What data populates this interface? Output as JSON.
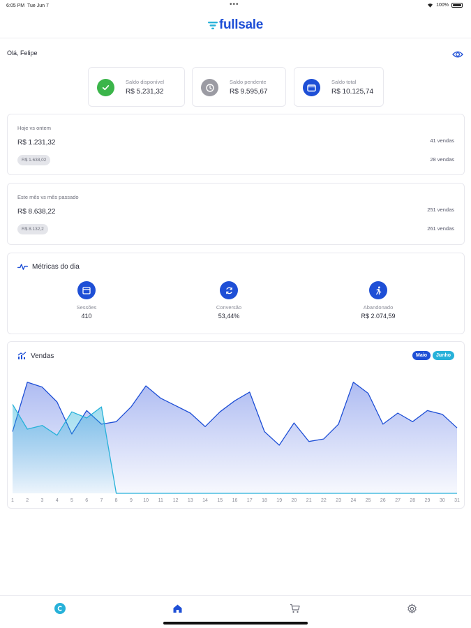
{
  "status_bar": {
    "time": "6:05 PM",
    "date": "Tue Jun 7",
    "battery": "100%"
  },
  "header": {
    "logo_text": "fullsale",
    "brand_color": "#1e4fd6",
    "accent_color": "#27b1d9"
  },
  "greeting": "Olá, Felipe",
  "balances": [
    {
      "label": "Saldo disponível",
      "value": "R$ 5.231,32",
      "icon": "check-icon",
      "color": "#3bb54a"
    },
    {
      "label": "Saldo pendente",
      "value": "R$ 9.595,67",
      "icon": "clock-icon",
      "color": "#9b9ba3"
    },
    {
      "label": "Saldo total",
      "value": "R$ 10.125,74",
      "icon": "wallet-icon",
      "color": "#1e4fd6"
    }
  ],
  "today_vs_yesterday": {
    "title": "Hoje vs ontem",
    "value": "R$ 1.231,32",
    "previous": "R$ 1.638,02",
    "sales_current": "41 vendas",
    "sales_previous": "28 vendas"
  },
  "month_vs_last": {
    "title": "Este mês vs mês passado",
    "value": "R$ 8.638,22",
    "previous": "R$ 8.132,2",
    "sales_current": "251 vendas",
    "sales_previous": "261 vendas"
  },
  "metrics": {
    "title": "Métricas do dia",
    "items": [
      {
        "label": "Sessões",
        "value": "410",
        "icon": "browser-icon"
      },
      {
        "label": "Conversão",
        "value": "53,44%",
        "icon": "refresh-icon"
      },
      {
        "label": "Abandonado",
        "value": "R$ 2.074,59",
        "icon": "running-icon"
      }
    ]
  },
  "sales_chart": {
    "title": "Vendas",
    "legend": [
      {
        "label": "Maio",
        "color": "#1e4fd6"
      },
      {
        "label": "Junho",
        "color": "#27b1d9"
      }
    ]
  },
  "chart_data": {
    "type": "area",
    "x": [
      1,
      2,
      3,
      4,
      5,
      6,
      7,
      8,
      9,
      10,
      11,
      12,
      13,
      14,
      15,
      16,
      17,
      18,
      19,
      20,
      21,
      22,
      23,
      24,
      25,
      26,
      27,
      28,
      29,
      30,
      31
    ],
    "tick_labels": [
      "1",
      "2",
      "3",
      "4",
      "5",
      "6",
      "7",
      "8",
      "9",
      "10",
      "11",
      "12",
      "13",
      "14",
      "15",
      "16",
      "17",
      "18",
      "19",
      "20",
      "21",
      "22",
      "23",
      "24",
      "25",
      "26",
      "27",
      "28",
      "29",
      "30",
      "31"
    ],
    "ylim": [
      0,
      100
    ],
    "grid": false,
    "legend_position": "top-right",
    "series": [
      {
        "name": "Maio",
        "color": "#1e4fd6",
        "values": [
          50,
          90,
          86,
          74,
          48,
          67,
          56,
          58,
          70,
          87,
          77,
          71,
          65,
          54,
          66,
          75,
          82,
          50,
          39,
          57,
          42,
          44,
          56,
          90,
          81,
          56,
          65,
          58,
          67,
          64,
          53
        ]
      },
      {
        "name": "Junho",
        "color": "#27b1d9",
        "values": [
          72,
          52,
          55,
          47,
          66,
          61,
          70,
          0,
          0,
          0,
          0,
          0,
          0,
          0,
          0,
          0,
          0,
          0,
          0,
          0,
          0,
          0,
          0,
          0,
          0,
          0,
          0,
          0,
          0,
          0,
          0
        ]
      }
    ]
  },
  "tabbar": {
    "items": [
      {
        "name": "profile",
        "icon": "profile-icon"
      },
      {
        "name": "home",
        "icon": "home-icon"
      },
      {
        "name": "cart",
        "icon": "cart-icon"
      },
      {
        "name": "settings",
        "icon": "gear-icon"
      }
    ]
  }
}
